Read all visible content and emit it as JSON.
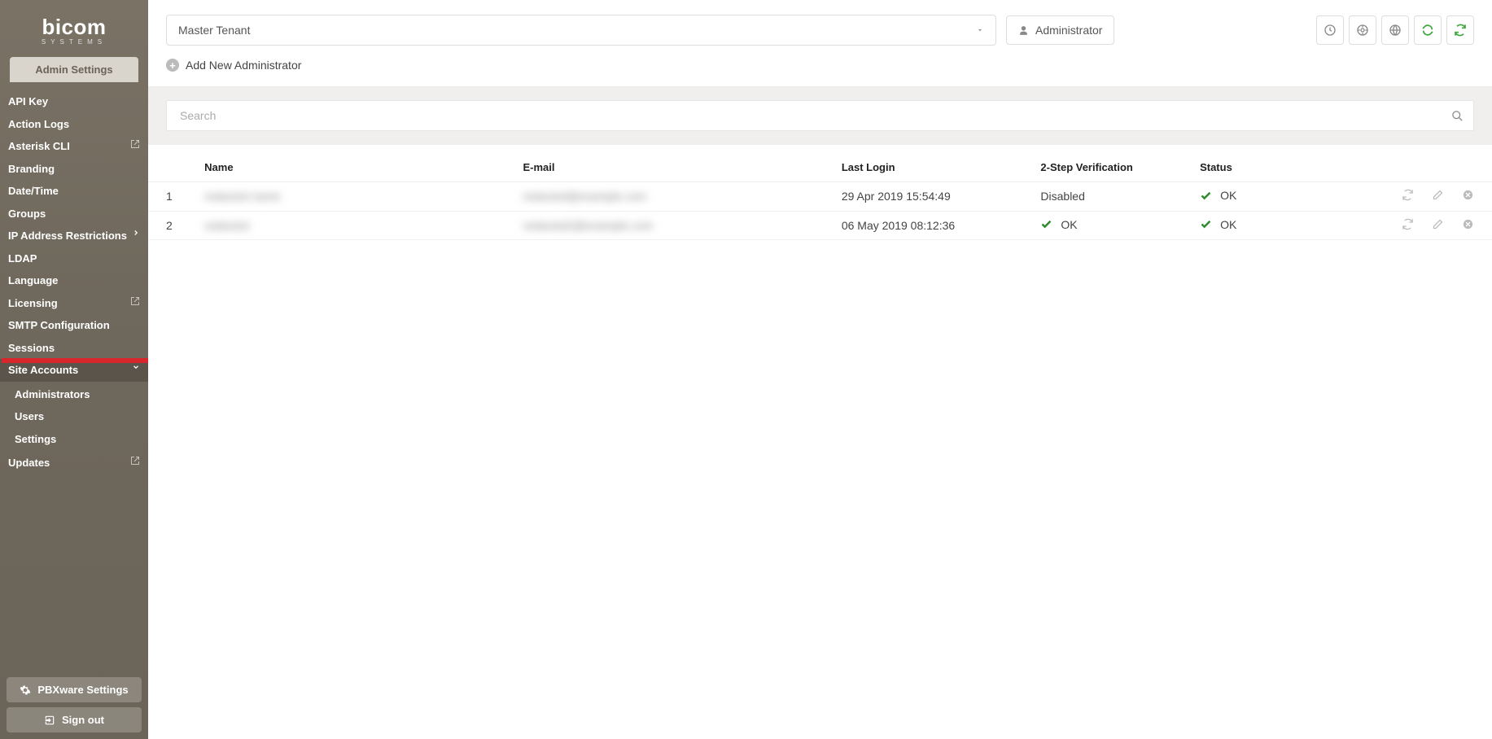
{
  "logo": {
    "brand": "bicom",
    "sub": "SYSTEMS"
  },
  "admin_tab": "Admin Settings",
  "sidebar": {
    "items": [
      {
        "label": "API Key"
      },
      {
        "label": "Action Logs"
      },
      {
        "label": "Asterisk CLI",
        "ext": true
      },
      {
        "label": "Branding"
      },
      {
        "label": "Date/Time"
      },
      {
        "label": "Groups"
      },
      {
        "label": "IP Address Restrictions",
        "arrow": true
      },
      {
        "label": "LDAP"
      },
      {
        "label": "Language"
      },
      {
        "label": "Licensing",
        "ext": true
      },
      {
        "label": "SMTP Configuration"
      },
      {
        "label": "Sessions"
      },
      {
        "label": "Site Accounts",
        "expanded": true,
        "active": true,
        "children": [
          {
            "label": "Administrators"
          },
          {
            "label": "Users"
          },
          {
            "label": "Settings"
          }
        ]
      },
      {
        "label": "Updates",
        "ext": true
      }
    ],
    "bottom": {
      "pbxware": "PBXware Settings",
      "signout": "Sign out"
    }
  },
  "toolbar": {
    "tenant": "Master Tenant",
    "admin_btn": "Administrator"
  },
  "add_link": "Add New Administrator",
  "search": {
    "placeholder": "Search"
  },
  "table": {
    "headers": {
      "name": "Name",
      "email": "E-mail",
      "last_login": "Last Login",
      "twostep": "2-Step Verification",
      "status": "Status"
    },
    "rows": [
      {
        "idx": "1",
        "name": "redacted name",
        "email": "redacted@example.com",
        "last_login": "29 Apr 2019 15:54:49",
        "twostep_text": "Disabled",
        "twostep_ok": false,
        "status": "OK"
      },
      {
        "idx": "2",
        "name": "redacted",
        "email": "redacted2@example.com",
        "last_login": "06 May 2019 08:12:36",
        "twostep_text": "OK",
        "twostep_ok": true,
        "status": "OK"
      }
    ]
  }
}
